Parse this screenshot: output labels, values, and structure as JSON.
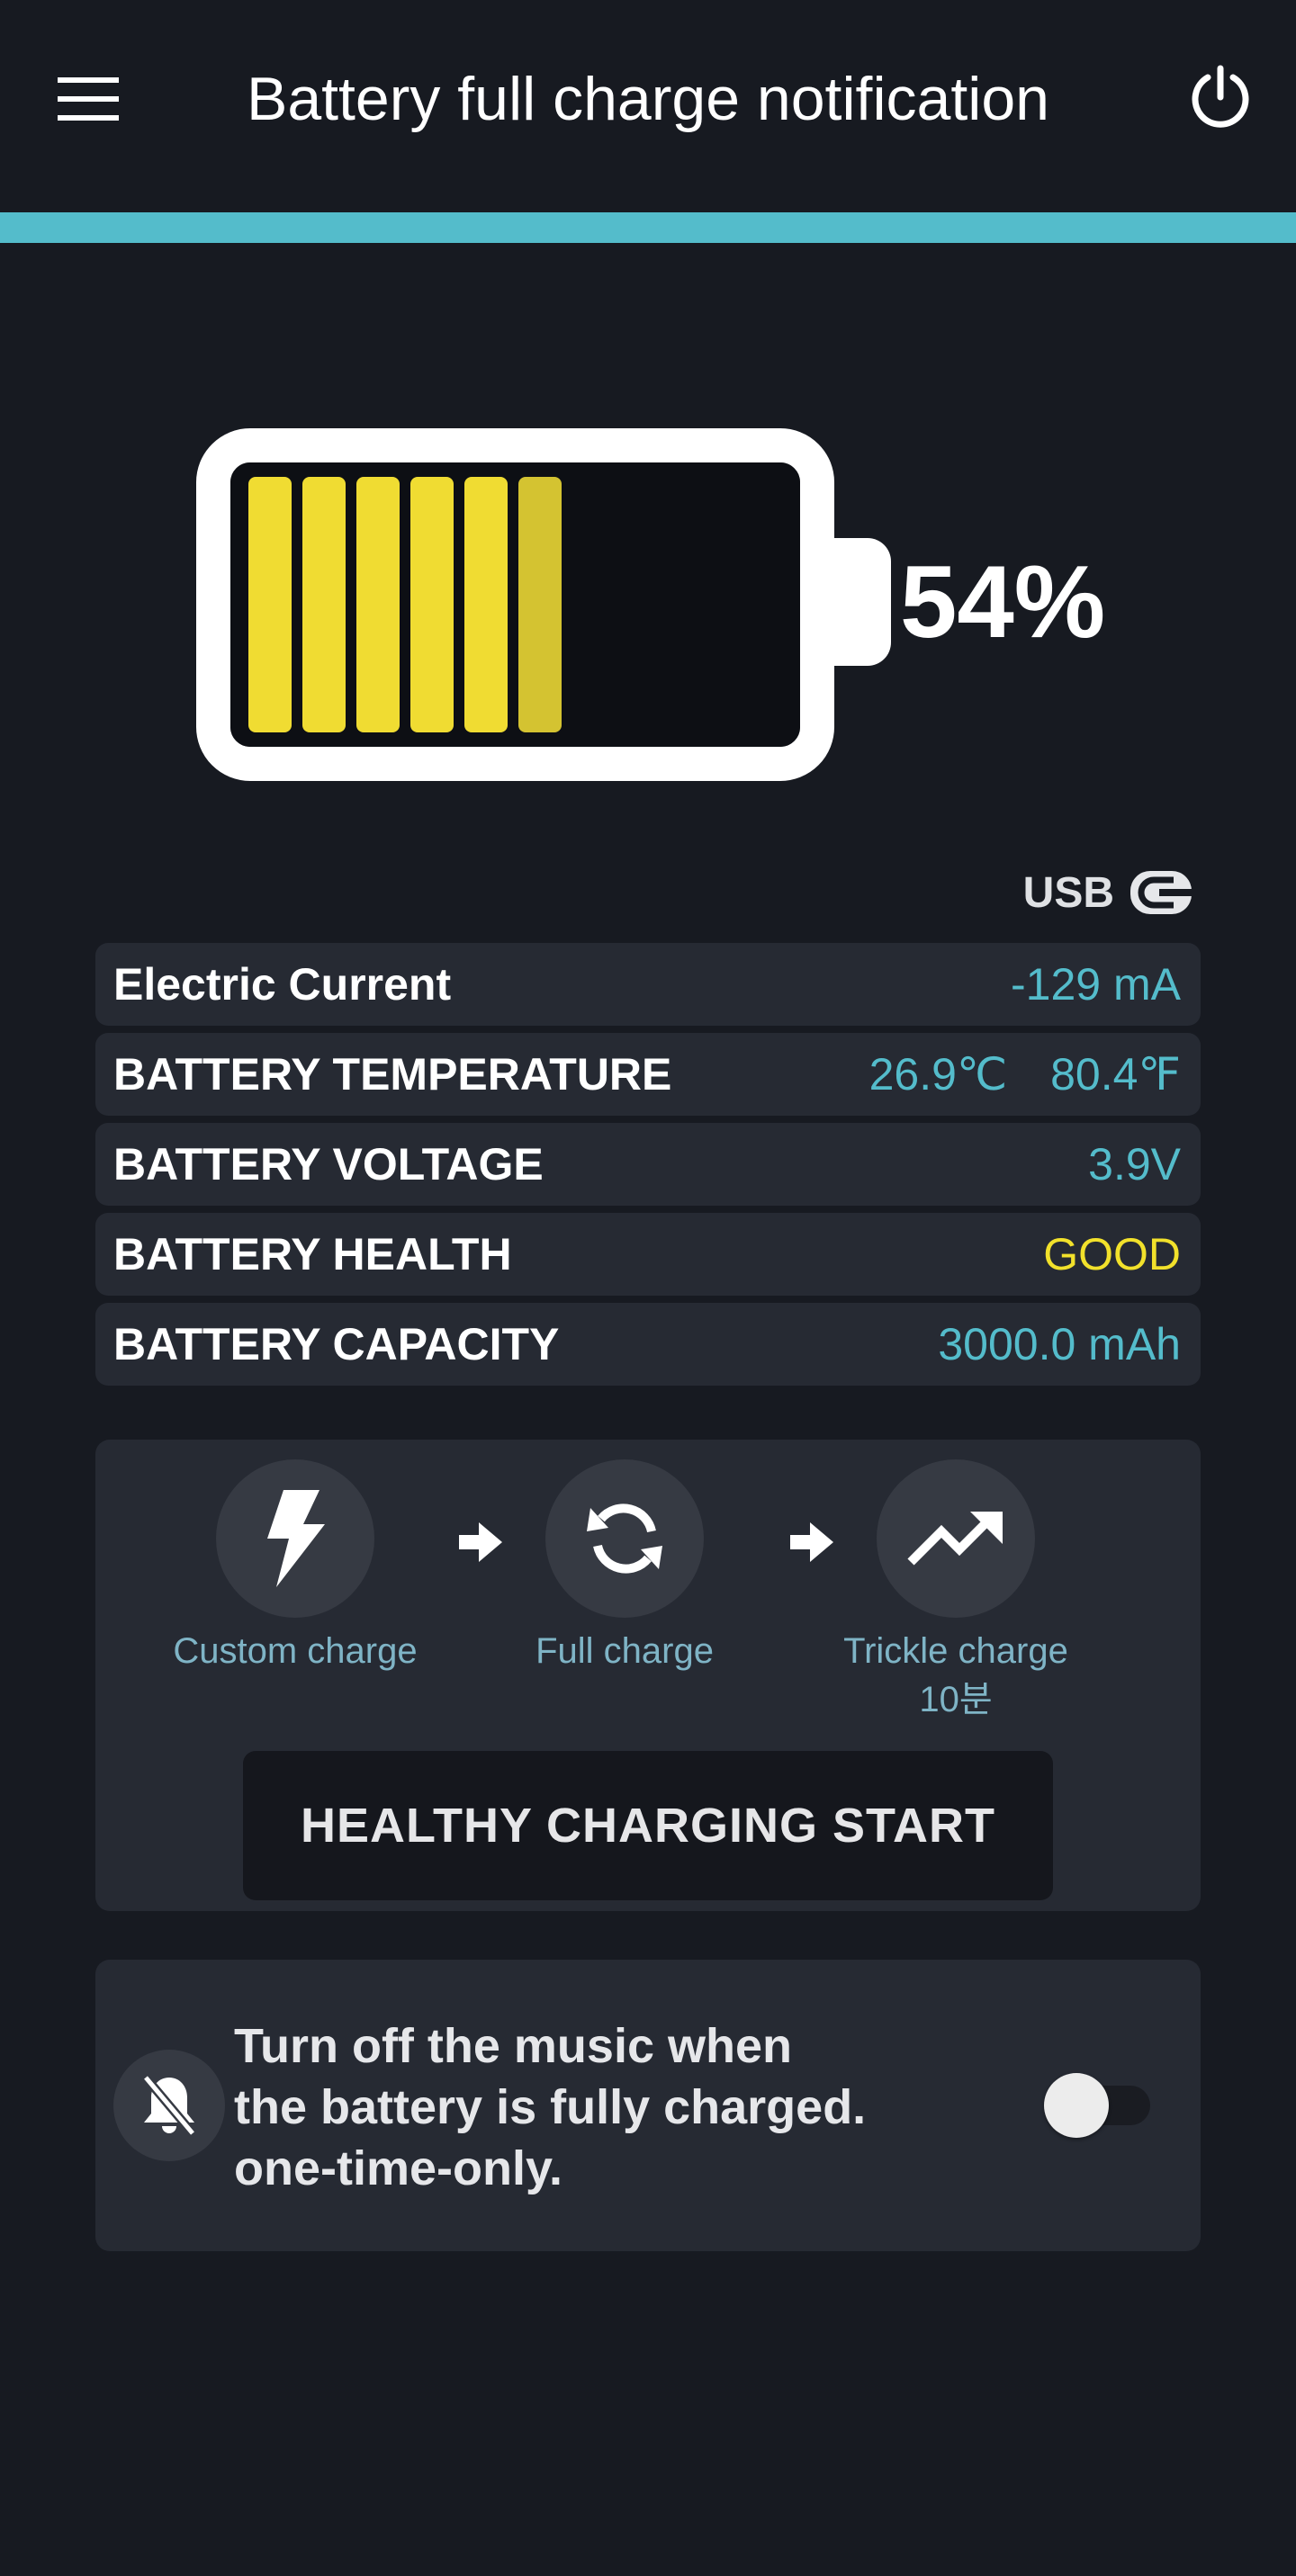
{
  "app_bar": {
    "title": "Battery full charge notification",
    "menu_icon": "hamburger-menu-icon",
    "power_icon": "power-icon"
  },
  "colors": {
    "background": "#171a21",
    "accent": "#54bccb",
    "cell_full": "#f0dc32",
    "cell_partial": "#d4c331",
    "value_text": "#54bccb",
    "health_good": "#f2e12b"
  },
  "battery": {
    "level_percent": 54,
    "percent_text": "54%",
    "cells_filled": 6
  },
  "power_source": {
    "label": "USB",
    "icon": "usb-plug-icon"
  },
  "info_rows": {
    "current": {
      "label": "Electric Current",
      "value": "-129 mA"
    },
    "temperature": {
      "label": "BATTERY TEMPERATURE",
      "celsius": "26.9℃",
      "fahrenheit": "80.4℉"
    },
    "voltage": {
      "label": "BATTERY VOLTAGE",
      "value": "3.9V"
    },
    "health": {
      "label": "BATTERY HEALTH",
      "value": "GOOD"
    },
    "capacity": {
      "label": "BATTERY CAPACITY",
      "value": "3000.0 mAh"
    }
  },
  "charging_steps": {
    "custom": {
      "label": "Custom charge",
      "icon": "lightning-icon"
    },
    "full": {
      "label": "Full charge",
      "icon": "refresh-cycle-icon"
    },
    "trickle": {
      "label": "Trickle charge",
      "sub": "10분",
      "icon": "trending-up-icon"
    }
  },
  "start_button": {
    "label": "HEALTHY CHARGING START"
  },
  "music_option": {
    "line1": "Turn off the music when",
    "line2": "the battery is fully charged.",
    "line3": "one-time-only.",
    "icon": "bell-off-icon",
    "toggle_on": false
  }
}
